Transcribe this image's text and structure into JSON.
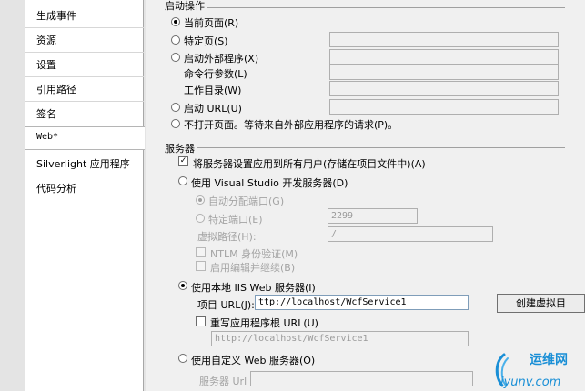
{
  "sidebar": {
    "items": [
      {
        "label": "生成事件"
      },
      {
        "label": "资源"
      },
      {
        "label": "设置"
      },
      {
        "label": "引用路径"
      },
      {
        "label": "签名"
      },
      {
        "label": "Web*"
      },
      {
        "label": "Silverlight 应用程序"
      },
      {
        "label": "代码分析"
      }
    ]
  },
  "start_action": {
    "group_label": "启动操作",
    "current_page": "当前页面(R)",
    "specific_page": "特定页(S)",
    "external_program": "启动外部程序(X)",
    "cmd_args": "命令行参数(L)",
    "working_dir": "工作目录(W)",
    "start_url": "启动 URL(U)",
    "dont_open": "不打开页面。等待来自外部应用程序的请求(P)。"
  },
  "servers": {
    "group_label": "服务器",
    "apply_all_users": "将服务器设置应用到所有用户(存储在项目文件中)(A)",
    "use_vs_dev": "使用 Visual Studio 开发服务器(D)",
    "auto_port": "自动分配端口(G)",
    "specific_port": "特定端口(E)",
    "port_value": "2299",
    "virtual_path_label": "虚拟路径(H):",
    "virtual_path_value": "/",
    "ntlm": "NTLM 身份验证(M)",
    "edit_continue": "启用编辑并继续(B)",
    "use_local_iis": "使用本地 IIS Web 服务器(I)",
    "project_url_label": "项目 URL(J):",
    "project_url_value": "ttp://localhost/WcfService1",
    "create_vdir": "创建虚拟目",
    "override_root": "重写应用程序根 URL(U)",
    "override_value": "http://localhost/WcfService1",
    "use_custom": "使用自定义 Web 服务器(O)",
    "server_url_label": "服务器 Url"
  },
  "watermark": {
    "cn": "运维网",
    "domain": "iyunv.com"
  },
  "colors": {
    "accent": "#1a8fd6",
    "disabled_text": "#a3a3a3"
  }
}
